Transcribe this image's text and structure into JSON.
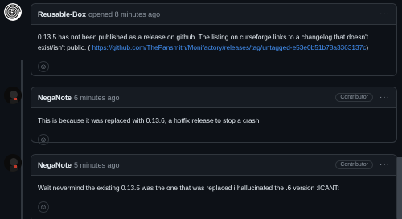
{
  "comments": [
    {
      "author": "Reusable-Box",
      "meta": "opened 8 minutes ago",
      "badge": "",
      "body_text": "0.13.5 has not been published as a release on github. The listing on curseforge links to a changelog that doesn't exist/isn't public. (",
      "body_link": "https://github.com/ThePansmith/Monifactory/releases/tag/untagged-e53e0b51b78a3363137c",
      "body_end": ")",
      "reaction_icon": "smiley-icon"
    },
    {
      "author": "NegaNote",
      "meta": "6 minutes ago",
      "badge": "Contributor",
      "body_text": "This is because it was replaced with 0.13.6, a hotfix release to stop a crash.",
      "reaction_icon": "smiley-icon"
    },
    {
      "author": "NegaNote",
      "meta": "5 minutes ago",
      "badge": "Contributor",
      "body_text": "Wait nevermind the existing 0.13.5 was the one that was replaced i hallucinated the .6 version :ICANT:",
      "reaction_icon": "smiley-icon"
    }
  ],
  "menu_dots": "···",
  "reaction_glyph": "☺",
  "colors": {
    "background": "#0d1117",
    "header_bg": "#161b22",
    "border": "#30363d",
    "link": "#4493f8",
    "muted": "#8d96a0"
  }
}
